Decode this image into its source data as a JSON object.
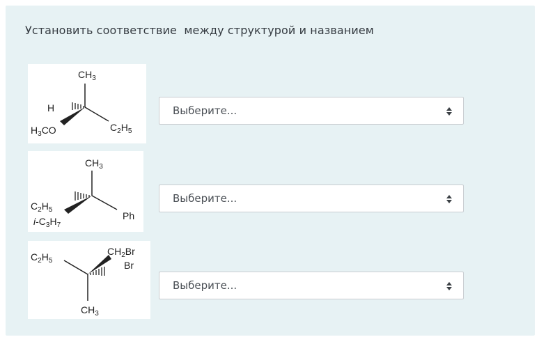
{
  "question": {
    "text": "Установить соответствие  между структурой и названием"
  },
  "rows": [
    {
      "structure_icon": "chiral-molecule-1",
      "labels": {
        "top": "CH3",
        "left": "H",
        "bottom_left": "H3CO",
        "right": "C2H5"
      },
      "select": {
        "value": "Выберите..."
      }
    },
    {
      "structure_icon": "chiral-molecule-2",
      "labels": {
        "top": "CH3",
        "left": "C2H5",
        "bottom_left": "i-C3H7",
        "right": "Ph"
      },
      "select": {
        "value": "Выберите..."
      }
    },
    {
      "structure_icon": "chiral-molecule-3",
      "labels": {
        "left": "C2H5",
        "top_right": "CH2Br",
        "right": "Br",
        "bottom": "CH3"
      },
      "select": {
        "value": "Выберите..."
      }
    }
  ],
  "colors": {
    "panel_bg": "#e7f2f4",
    "select_border": "#c8ccd0",
    "text": "#343a40"
  }
}
